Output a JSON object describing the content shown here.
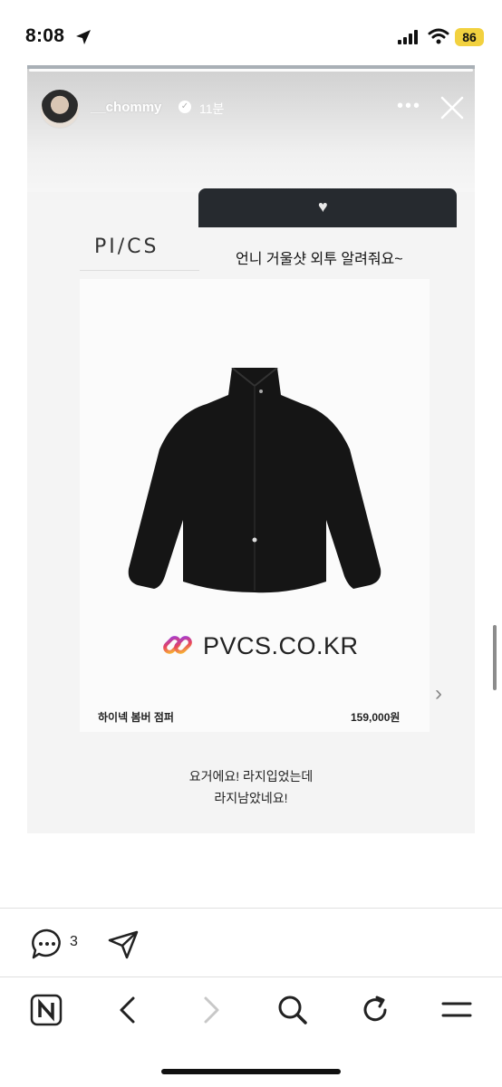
{
  "status_bar": {
    "time": "8:08",
    "battery": "86"
  },
  "story": {
    "username": "__chommy",
    "time_ago": "11분",
    "question": "언니 거울샷 외투 알려줘요~",
    "brand": "PI/CS",
    "product_url": "PVCS.CO.KR",
    "product_name": "하이넥 봄버 점퍼",
    "product_price": "159,000원",
    "caption_line1": "요거에요!  라지입었는데",
    "caption_line2": "라지남았네요!",
    "icons": [
      "verified-icon",
      "more-icon",
      "close-icon",
      "heart-icon",
      "chevron-right-icon",
      "link-icon"
    ]
  },
  "actions": {
    "comment_count": "3"
  },
  "browser_bar": {
    "icons": [
      "naver-icon",
      "back-icon",
      "forward-icon",
      "search-icon",
      "reload-icon",
      "menu-icon"
    ]
  }
}
